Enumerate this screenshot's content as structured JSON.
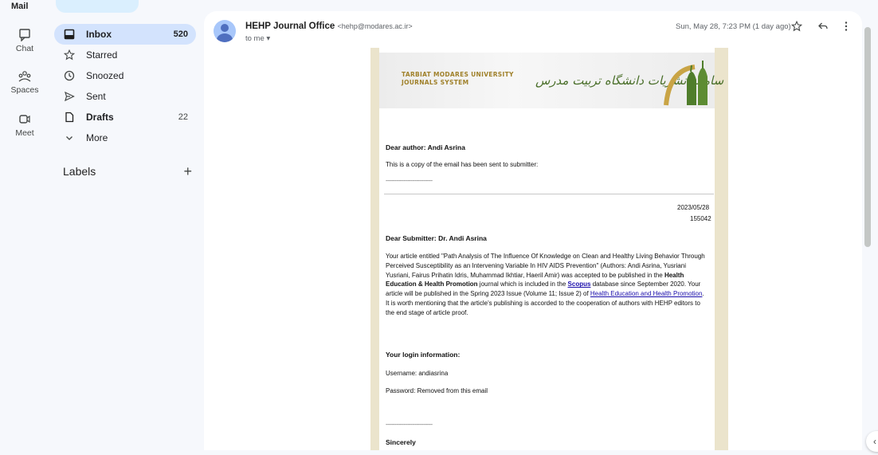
{
  "rail": {
    "top_label": "Mail",
    "items": [
      {
        "label": "Chat"
      },
      {
        "label": "Spaces"
      },
      {
        "label": "Meet"
      }
    ]
  },
  "nav": {
    "items": [
      {
        "label": "Inbox",
        "count": "520"
      },
      {
        "label": "Starred",
        "count": ""
      },
      {
        "label": "Snoozed",
        "count": ""
      },
      {
        "label": "Sent",
        "count": ""
      },
      {
        "label": "Drafts",
        "count": "22"
      },
      {
        "label": "More",
        "count": ""
      }
    ],
    "labels_title": "Labels",
    "labels_add": "+"
  },
  "message": {
    "sender_name": "HEHP Journal Office",
    "sender_address": "<hehp@modares.ac.ir>",
    "to": "to me ▾",
    "date": "Sun, May 28, 7:23 PM (1 day ago)"
  },
  "email": {
    "banner_en_line1": "TARBIAT MODARES UNIVERSITY",
    "banner_en_line2": "JOURNALS SYSTEM",
    "banner_fa": "سامانه نشریات دانشگاه تربیت مدرس",
    "dear_author": "Dear author: Andi Asrina",
    "copy_note": "This is a copy of the email has been sent to submitter:",
    "dashes": "--------------------------------",
    "date_line": "2023/05/28",
    "ref_number": "155042",
    "dear_submitter": "Dear Submitter: Dr. Andi Asrina",
    "para_1": "Your article entitled \"Path Analysis of The Influence Of Knowledge on Clean and Healthy Living Behavior Through Perceived Susceptibility as an Intervening Variable In HIV AIDS Prevention\" (Authors: Andi Asrina, Yusriani Yusriani, Fairus Prihatin Idris, Muhammad Ikhtiar, Haeril Amir) was accepted to be published in the",
    "journal_name": "Health Education & Health Promotion",
    "para_2": "journal which is included in the",
    "scopus": "Scopus",
    "para_3": "database since September 2020. Your article will be published in the Spring 2023 Issue (Volume 11; Issue 2) of",
    "journal_link": "Health Education and Health Promotion",
    "para_4": ". It is worth mentioning that the article's publishing is accorded to the cooperation of authors with HEHP editors to the end stage of article proof.",
    "login_title": "Your login information:",
    "username": "Username: andiasrina",
    "password": "Password: Removed from this email",
    "sincerely": "Sincerely"
  }
}
